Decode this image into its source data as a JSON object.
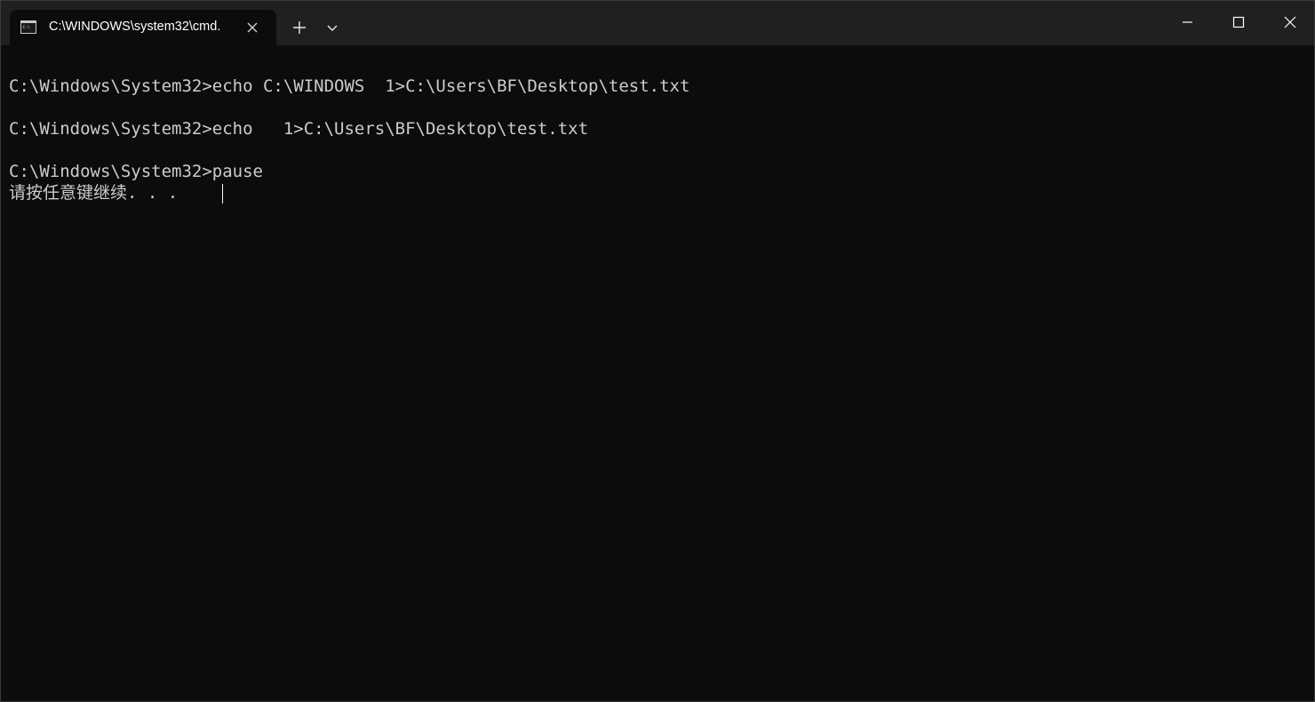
{
  "tab": {
    "title": "C:\\WINDOWS\\system32\\cmd.",
    "icon": "terminal-icon"
  },
  "toolbar": {
    "new_tab_icon": "plus-icon",
    "dropdown_icon": "chevron-down-icon"
  },
  "window_controls": {
    "minimize_icon": "minimize-icon",
    "maximize_icon": "maximize-icon",
    "close_icon": "close-icon"
  },
  "terminal": {
    "lines": [
      "C:\\Windows\\System32>echo C:\\WINDOWS  1>C:\\Users\\BF\\Desktop\\test.txt",
      "C:\\Windows\\System32>echo   1>C:\\Users\\BF\\Desktop\\test.txt",
      "C:\\Windows\\System32>pause",
      "请按任意键继续. . ."
    ]
  },
  "colors": {
    "background": "#0c0c0c",
    "titlebar": "#202020",
    "text": "#cccccc"
  }
}
